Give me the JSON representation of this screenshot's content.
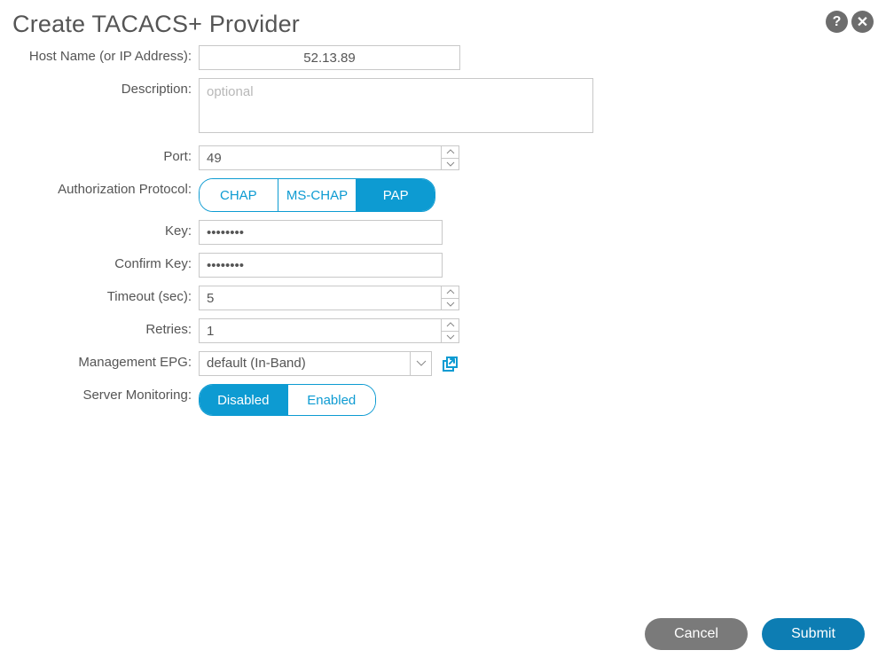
{
  "title": "Create TACACS+ Provider",
  "labels": {
    "hostname": "Host Name (or IP Address):",
    "description": "Description:",
    "port": "Port:",
    "auth_protocol": "Authorization Protocol:",
    "key": "Key:",
    "confirm_key": "Confirm Key:",
    "timeout": "Timeout (sec):",
    "retries": "Retries:",
    "mgmt_epg": "Management EPG:",
    "server_monitoring": "Server Monitoring:"
  },
  "values": {
    "hostname": "52.13.89",
    "description": "",
    "description_placeholder": "optional",
    "port": "49",
    "key": "••••••••",
    "confirm_key": "••••••••",
    "timeout": "5",
    "retries": "1",
    "mgmt_epg": "default (In-Band)"
  },
  "auth_protocol": {
    "options": [
      "CHAP",
      "MS-CHAP",
      "PAP"
    ],
    "selected": "PAP"
  },
  "server_monitoring": {
    "options": [
      "Disabled",
      "Enabled"
    ],
    "selected": "Disabled"
  },
  "buttons": {
    "cancel": "Cancel",
    "submit": "Submit"
  },
  "icons": {
    "help": "?",
    "close": "✕"
  }
}
